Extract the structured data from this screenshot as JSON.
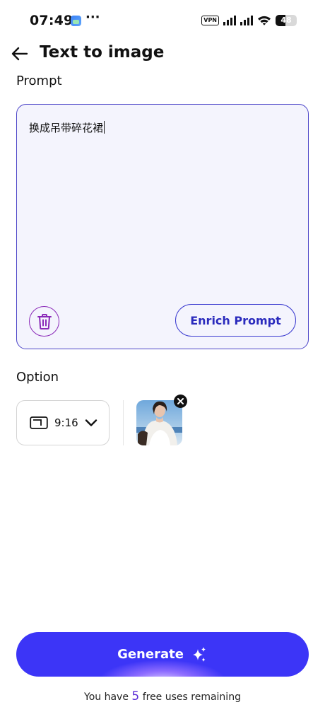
{
  "status_bar": {
    "time": "07:49",
    "more": "···",
    "vpn": "VPN",
    "battery": 48
  },
  "header": {
    "title": "Text to image",
    "back_icon": "arrow-left-icon"
  },
  "prompt": {
    "label": "Prompt",
    "value": "换成吊带碎花裙",
    "delete_icon": "trash-icon",
    "enrich_label": "Enrich Prompt"
  },
  "option": {
    "label": "Option",
    "aspect_ratio": "9:16",
    "aspect_icon": "aspect-ratio-icon",
    "dropdown_icon": "chevron-down-icon",
    "reference_image_icon": "reference-photo-thumbnail",
    "remove_icon": "close-icon"
  },
  "generate": {
    "label": "Generate",
    "icon": "sparkle-icon"
  },
  "usage": {
    "prefix": "You have",
    "count": "5",
    "suffix": "free uses remaining"
  },
  "colors": {
    "accent": "#3c35f7",
    "prompt_border": "#4c45c8",
    "prompt_bg": "#f4f4fd",
    "delete_purple": "#8a28b8"
  }
}
